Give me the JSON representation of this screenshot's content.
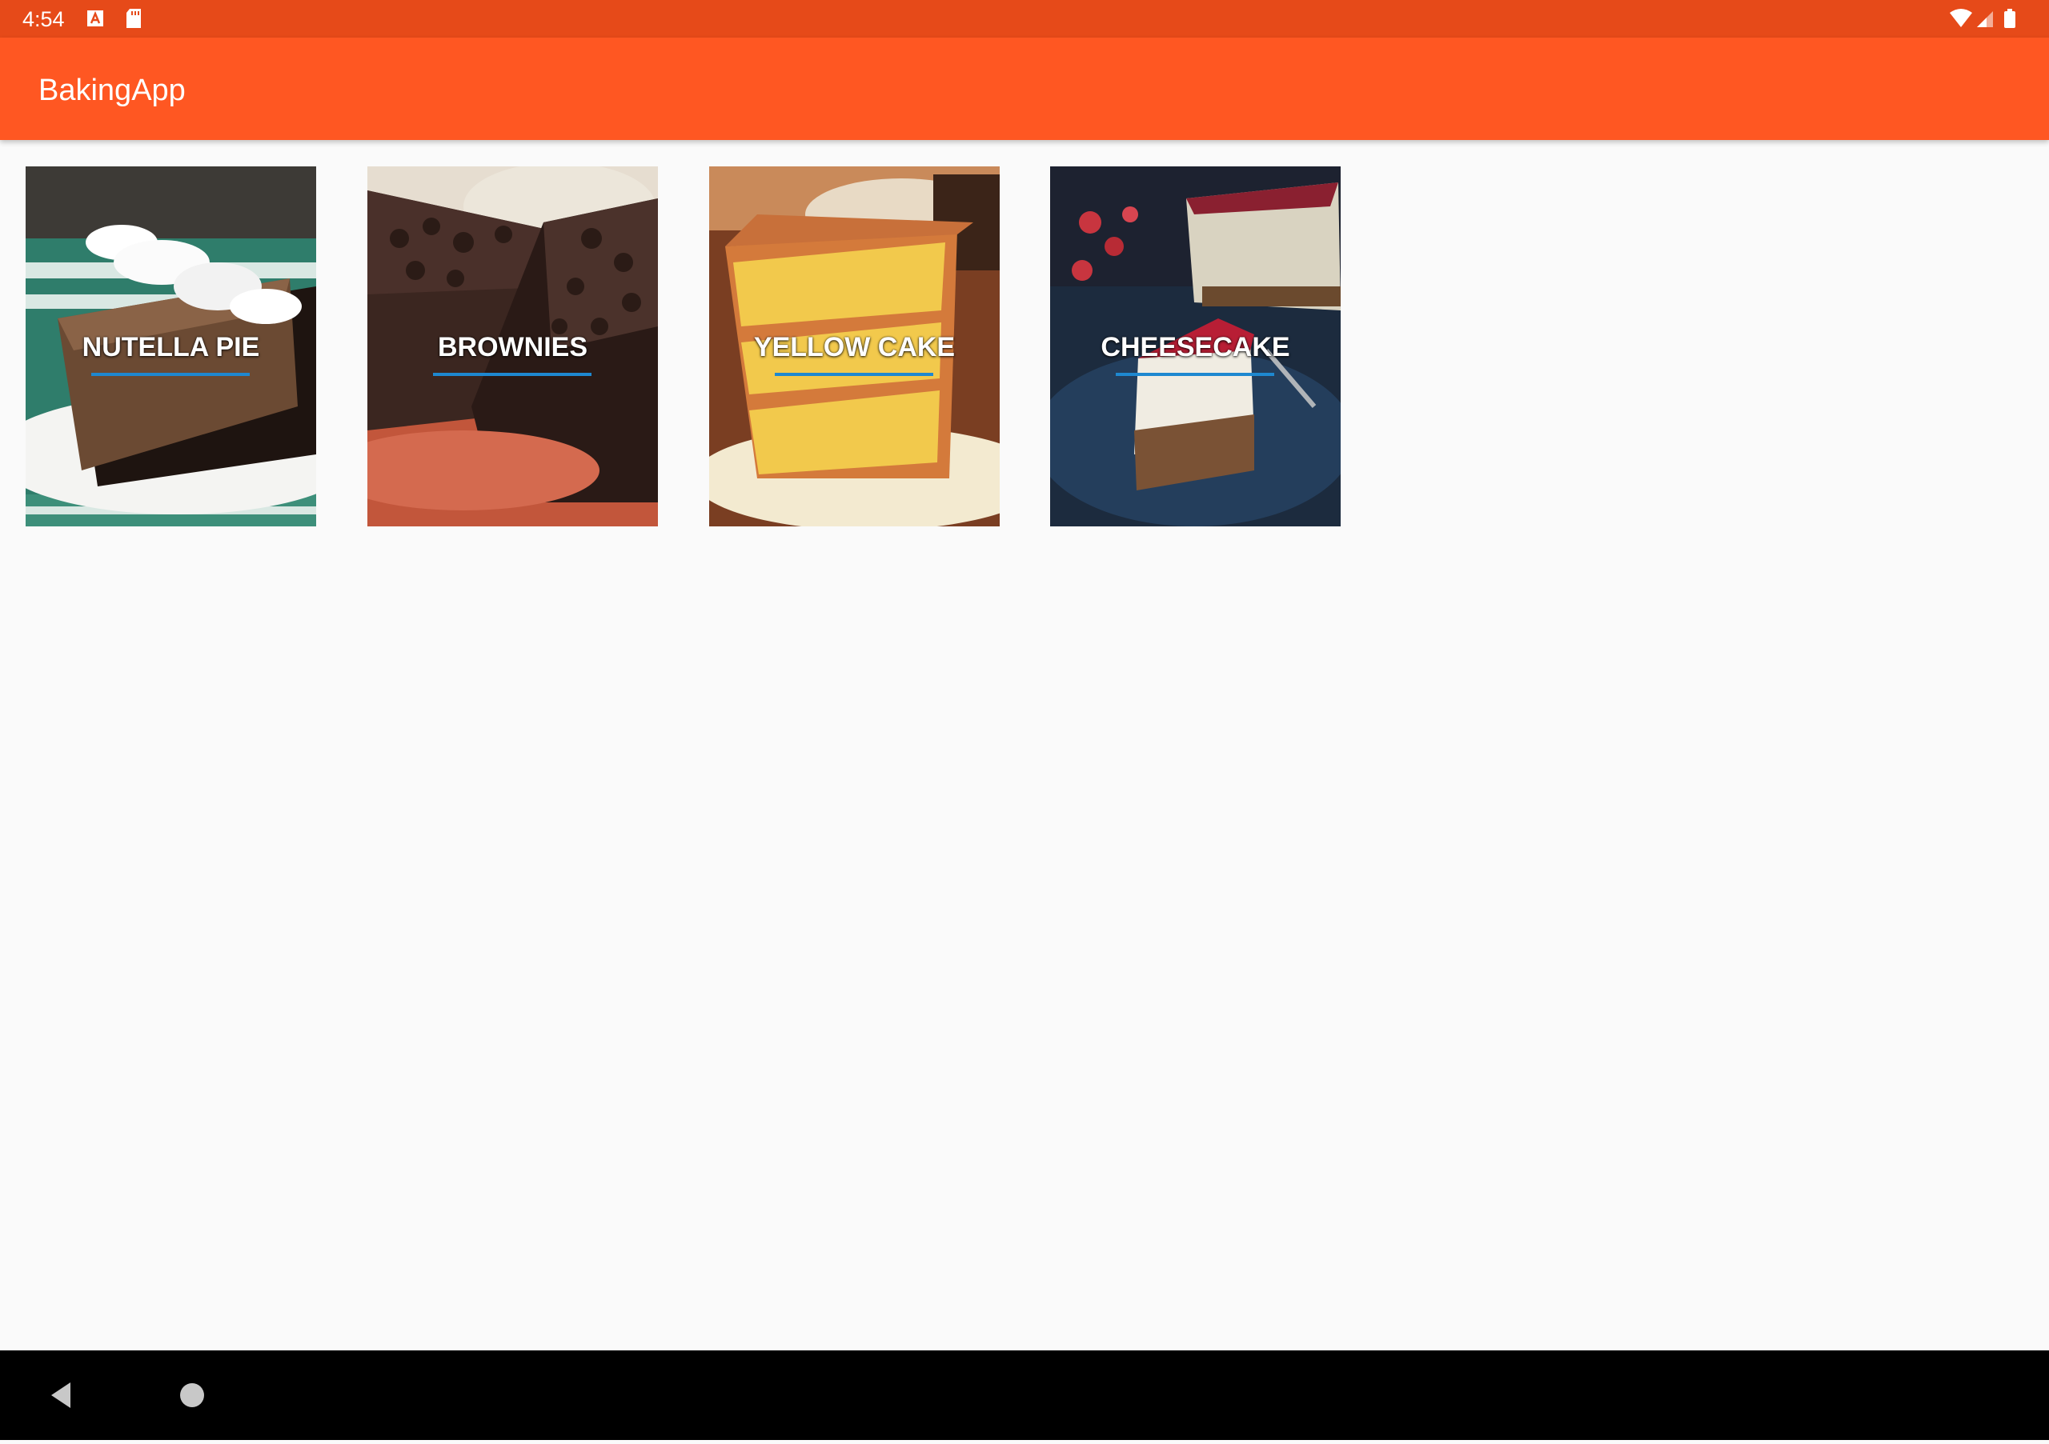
{
  "status_bar": {
    "time": "4:54",
    "icons_left": [
      "text-a-icon",
      "sd-card-icon"
    ],
    "icons_right": [
      "wifi-icon",
      "cell-signal-icon",
      "battery-icon"
    ]
  },
  "app_bar": {
    "title": "BakingApp",
    "color": "#ff5722",
    "status_color": "#e64a19"
  },
  "recipes": [
    {
      "name": "NUTELLA PIE",
      "image": "chocolate-pie-slice"
    },
    {
      "name": "BROWNIES",
      "image": "brownie-slab"
    },
    {
      "name": "YELLOW CAKE",
      "image": "layer-cake-slice"
    },
    {
      "name": "CHEESECAKE",
      "image": "cheesecake-slice"
    }
  ],
  "underline_color": "#1e88d0",
  "nav_bar": {
    "buttons": [
      "back-icon",
      "home-icon"
    ]
  }
}
